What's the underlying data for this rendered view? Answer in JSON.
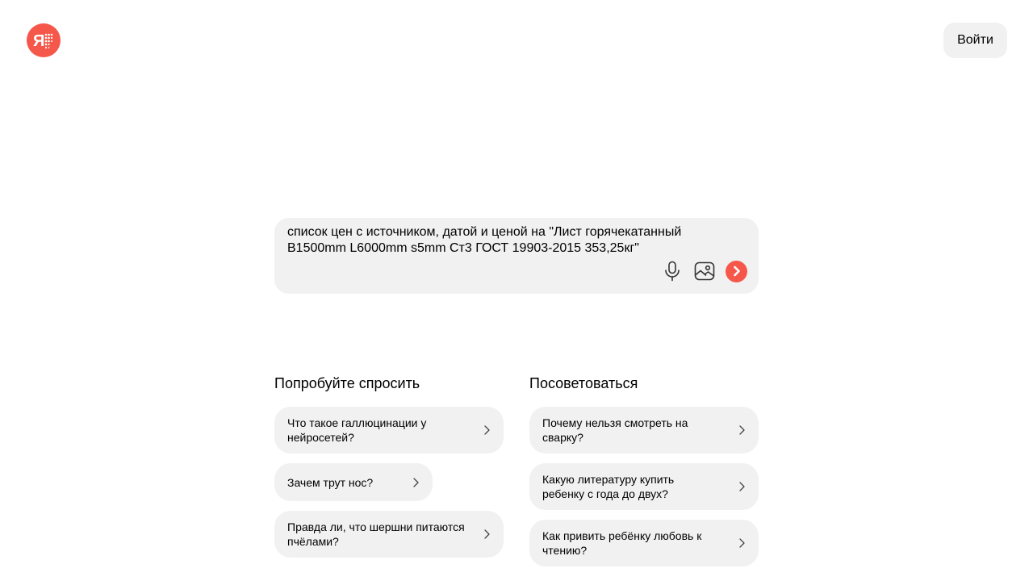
{
  "header": {
    "logo_icon": "yandex-alice-logo-icon",
    "logo_letter": "Я",
    "login_label": "Войти"
  },
  "prompt": {
    "text": "список цен с источником, датой и ценой на \"Лист горячекатанный В1500mm L6000mm s5mm Ст3 ГОСТ 19903-2015 353,25кг\"",
    "mic_icon": "microphone-icon",
    "image_icon": "image-upload-icon",
    "send_icon": "send-arrow-icon"
  },
  "suggestions": {
    "left": {
      "title": "Попробуйте спросить",
      "items": [
        {
          "label": "Что такое галлюцинации у нейросетей?"
        },
        {
          "label": "Зачем трут нос?"
        },
        {
          "label": "Правда ли, что шершни питаются пчёлами?"
        }
      ]
    },
    "right": {
      "title": "Посоветоваться",
      "items": [
        {
          "label": "Почему нельзя смотреть на сварку?"
        },
        {
          "label": "Какую литературу купить ребенку с года до двух?"
        },
        {
          "label": "Как привить ребёнку любовь к чтению?"
        }
      ]
    }
  },
  "colors": {
    "accent": "#f5584a",
    "surface": "#f1f1f1",
    "text": "#000000"
  }
}
